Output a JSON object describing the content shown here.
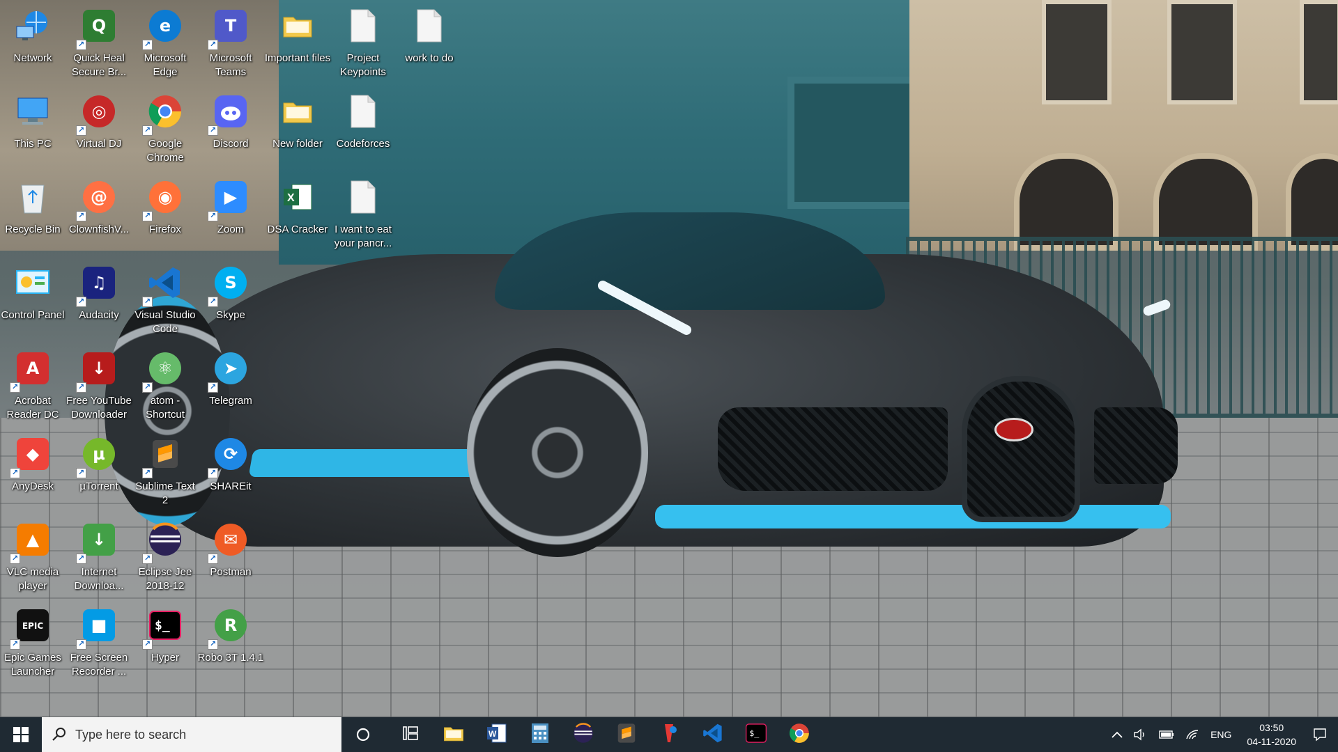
{
  "desktop": {
    "icons": [
      {
        "label": "Network",
        "icon": "network-icon",
        "color": "#1e88e5"
      },
      {
        "label": "This PC",
        "icon": "computer-icon",
        "color": "#42a5f5"
      },
      {
        "label": "Recycle Bin",
        "icon": "recycle-bin-icon",
        "color": "#b0bec5"
      },
      {
        "label": "Control Panel",
        "icon": "control-panel-icon",
        "color": "#29b6f6"
      },
      {
        "label": "Acrobat Reader DC",
        "icon": "acrobat-icon",
        "color": "#d32f2f"
      },
      {
        "label": "AnyDesk",
        "icon": "anydesk-icon",
        "color": "#ef443b"
      },
      {
        "label": "VLC media player",
        "icon": "vlc-icon",
        "color": "#f57c00"
      },
      {
        "label": "Epic Games Launcher",
        "icon": "epic-games-icon",
        "color": "#111111"
      },
      {
        "label": "Quick Heal Secure Br...",
        "icon": "quick-heal-icon",
        "color": "#2e7d32"
      },
      {
        "label": "Virtual DJ",
        "icon": "virtual-dj-icon",
        "color": "#c62828"
      },
      {
        "label": "ClownfishV...",
        "icon": "clownfish-icon",
        "color": "#ff7043"
      },
      {
        "label": "Audacity",
        "icon": "audacity-icon",
        "color": "#1a237e"
      },
      {
        "label": "Free YouTube Downloader",
        "icon": "youtube-downloader-icon",
        "color": "#b71c1c"
      },
      {
        "label": "µTorrent",
        "icon": "utorrent-icon",
        "color": "#76b82a"
      },
      {
        "label": "Internet Downloa...",
        "icon": "idm-icon",
        "color": "#43a047"
      },
      {
        "label": "Free Screen Recorder ...",
        "icon": "screen-recorder-icon",
        "color": "#039be5"
      },
      {
        "label": "Microsoft Edge",
        "icon": "edge-icon",
        "color": "#0c7bd3"
      },
      {
        "label": "Google Chrome",
        "icon": "chrome-icon",
        "color": "#fbc02d"
      },
      {
        "label": "Firefox",
        "icon": "firefox-icon",
        "color": "#ff7139"
      },
      {
        "label": "Visual Studio Code",
        "icon": "vscode-icon",
        "color": "#1976d2"
      },
      {
        "label": "atom - Shortcut",
        "icon": "atom-icon",
        "color": "#66bb6a"
      },
      {
        "label": "Sublime Text 2",
        "icon": "sublime-icon",
        "color": "#4e4e4e"
      },
      {
        "label": "Eclipse Jee 2018-12",
        "icon": "eclipse-icon",
        "color": "#2c2255"
      },
      {
        "label": "Hyper",
        "icon": "hyper-icon",
        "color": "#000000"
      },
      {
        "label": "Microsoft Teams",
        "icon": "teams-icon",
        "color": "#5059c9"
      },
      {
        "label": "Discord",
        "icon": "discord-icon",
        "color": "#5865f2"
      },
      {
        "label": "Zoom",
        "icon": "zoom-icon",
        "color": "#2d8cff"
      },
      {
        "label": "Skype",
        "icon": "skype-icon",
        "color": "#00aff0"
      },
      {
        "label": "Telegram",
        "icon": "telegram-icon",
        "color": "#2ca5e0"
      },
      {
        "label": "SHAREit",
        "icon": "shareit-icon",
        "color": "#1e88e5"
      },
      {
        "label": "Postman",
        "icon": "postman-icon",
        "color": "#ef5b25"
      },
      {
        "label": "Robo 3T 1.4.1",
        "icon": "robo3t-icon",
        "color": "#43a047"
      },
      {
        "label": "Important files",
        "icon": "folder-icon",
        "color": "#f2c94c"
      },
      {
        "label": "New folder",
        "icon": "folder-icon",
        "color": "#f2c94c"
      },
      {
        "label": "DSA Cracker",
        "icon": "excel-icon",
        "color": "#1d6f42"
      },
      {
        "label": "Project Keypoints",
        "icon": "text-file-icon",
        "color": "#f5f5f5"
      },
      {
        "label": "Codeforces",
        "icon": "text-file-icon",
        "color": "#f5f5f5"
      },
      {
        "label": "I want to eat your pancr...",
        "icon": "text-file-icon",
        "color": "#f5f5f5"
      },
      {
        "label": "work to do",
        "icon": "text-file-icon",
        "color": "#f5f5f5"
      }
    ]
  },
  "taskbar": {
    "search_placeholder": "Type here to search",
    "pinned": [
      {
        "name": "task-view",
        "icon": "task-view-icon"
      },
      {
        "name": "file-explorer",
        "icon": "folder-icon",
        "color": "#f2c94c"
      },
      {
        "name": "word",
        "icon": "word-icon",
        "color": "#2b579a"
      },
      {
        "name": "calculator",
        "icon": "calculator-icon",
        "color": "#4a90c2"
      },
      {
        "name": "eclipse",
        "icon": "eclipse-icon",
        "color": "#2c2255"
      },
      {
        "name": "sublime",
        "icon": "sublime-icon",
        "color": "#ff9800"
      },
      {
        "name": "paint-3d",
        "icon": "paint-icon",
        "color": "#e53935"
      },
      {
        "name": "vscode",
        "icon": "vscode-icon",
        "color": "#1976d2"
      },
      {
        "name": "hyper",
        "icon": "hyper-icon",
        "color": "#000000"
      },
      {
        "name": "chrome",
        "icon": "chrome-icon",
        "color": "#fbc02d"
      }
    ],
    "tray": {
      "language": "ENG",
      "time": "03:50",
      "date": "04-11-2020"
    }
  }
}
